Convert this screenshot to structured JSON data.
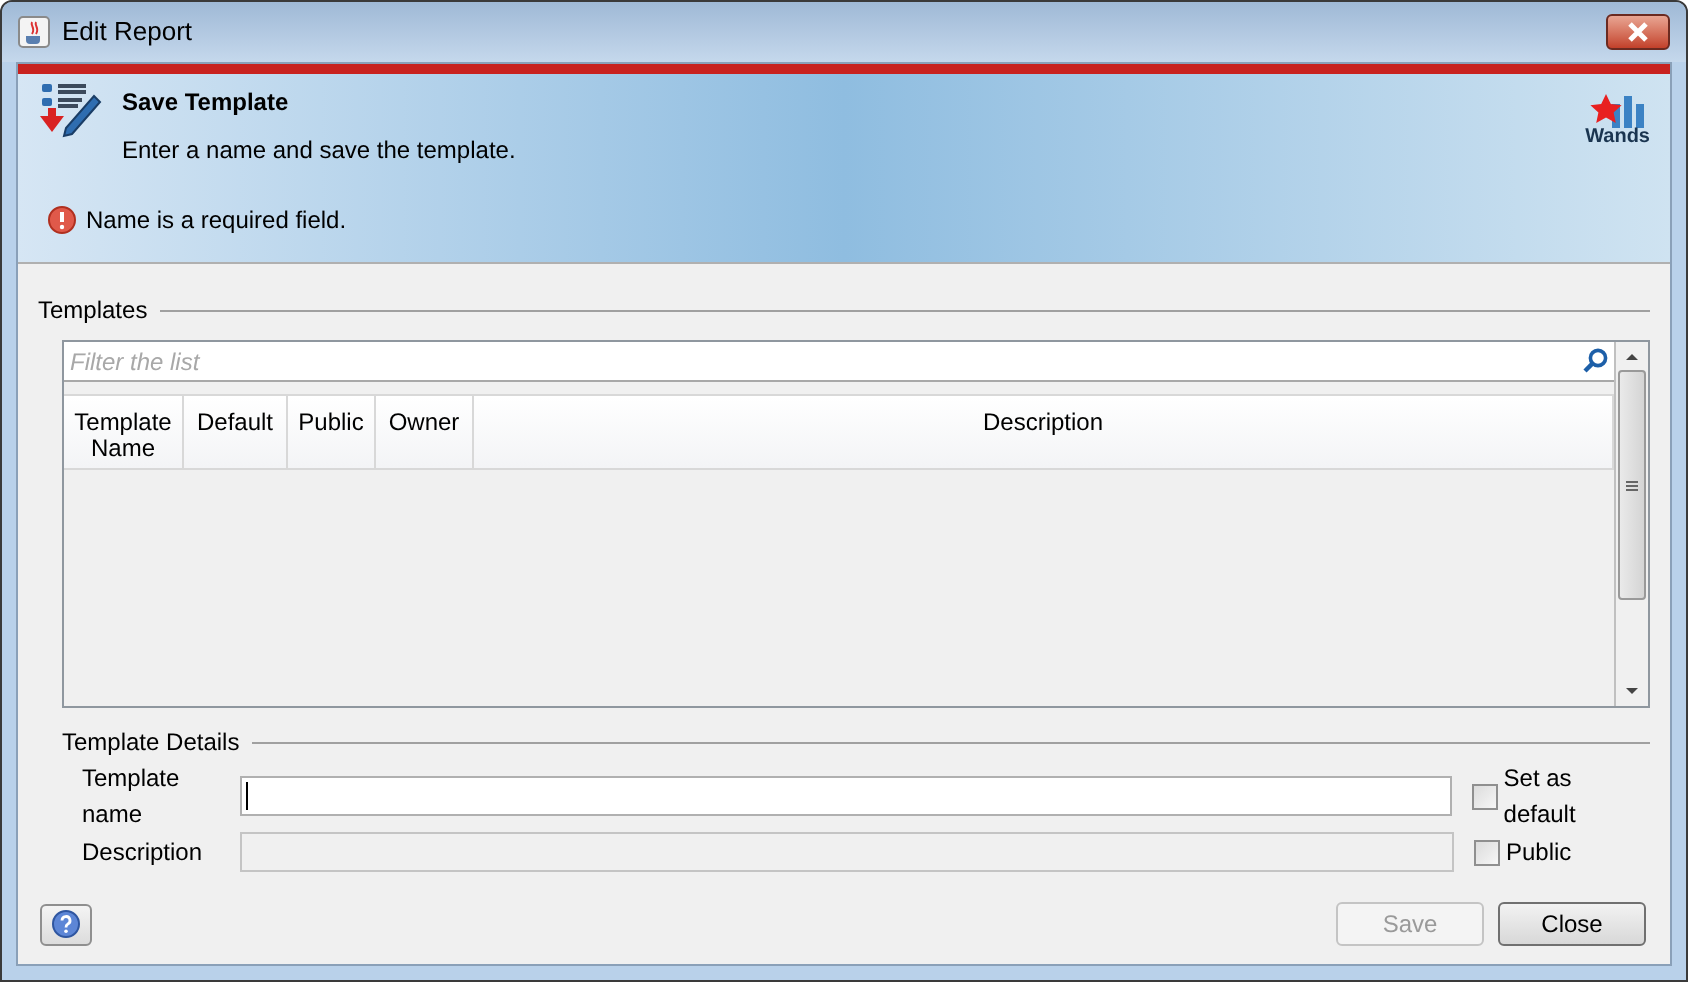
{
  "window": {
    "title": "Edit Report"
  },
  "header": {
    "title": "Save Template",
    "subtitle": "Enter a name and save the template.",
    "error": "Name is a required field.",
    "logo_text": "Wands"
  },
  "templates": {
    "label": "Templates",
    "filter": {
      "placeholder": "Filter the list"
    },
    "columns": [
      "Template Name",
      "Default",
      "Public",
      "Owner",
      "Description"
    ]
  },
  "details": {
    "label": "Template Details",
    "fields": [
      {
        "label": "Template name",
        "disabled": false,
        "focused": true,
        "option": {
          "label": "Set as default",
          "checked": false
        }
      },
      {
        "label": "Description",
        "disabled": true,
        "focused": false,
        "option": {
          "label": "Public",
          "checked": false
        }
      }
    ]
  },
  "buttons": [
    {
      "label": "Save",
      "disabled": true
    },
    {
      "label": "Close",
      "disabled": false
    }
  ]
}
